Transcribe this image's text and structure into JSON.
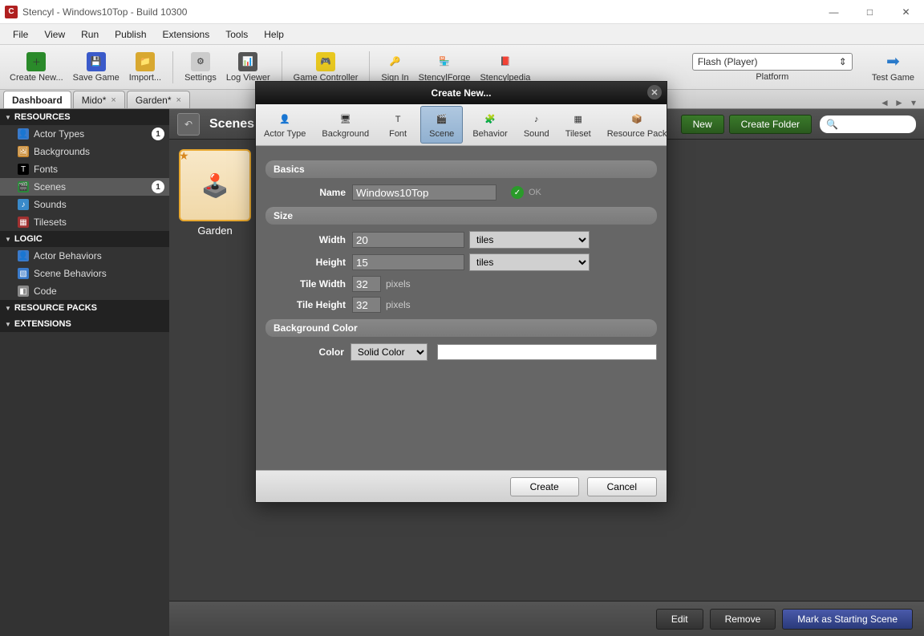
{
  "window": {
    "title": "Stencyl - Windows10Top - Build 10300"
  },
  "menu": [
    "File",
    "View",
    "Run",
    "Publish",
    "Extensions",
    "Tools",
    "Help"
  ],
  "toolbar": {
    "create_new": "Create New...",
    "save_game": "Save Game",
    "import": "Import...",
    "settings": "Settings",
    "log_viewer": "Log Viewer",
    "game_controller": "Game Controller",
    "sign_in": "Sign In",
    "stencylforge": "StencylForge",
    "stencylpedia": "Stencylpedia",
    "platform_label": "Platform",
    "platform_value": "Flash (Player)",
    "test_game": "Test Game"
  },
  "tabs": [
    {
      "label": "Dashboard",
      "active": true,
      "closable": false
    },
    {
      "label": "Mido*",
      "active": false,
      "closable": true
    },
    {
      "label": "Garden*",
      "active": false,
      "closable": true
    }
  ],
  "sidebar": {
    "groups": [
      {
        "title": "RESOURCES",
        "items": [
          {
            "label": "Actor Types",
            "icon": "actor",
            "count": "1"
          },
          {
            "label": "Backgrounds",
            "icon": "bg"
          },
          {
            "label": "Fonts",
            "icon": "font"
          },
          {
            "label": "Scenes",
            "icon": "scene",
            "count": "1",
            "active": true
          },
          {
            "label": "Sounds",
            "icon": "sound"
          },
          {
            "label": "Tilesets",
            "icon": "tile"
          }
        ]
      },
      {
        "title": "LOGIC",
        "items": [
          {
            "label": "Actor Behaviors",
            "icon": "actor"
          },
          {
            "label": "Scene Behaviors",
            "icon": "scenebeh"
          },
          {
            "label": "Code",
            "icon": "code"
          }
        ]
      },
      {
        "title": "RESOURCE PACKS",
        "items": []
      },
      {
        "title": "EXTENSIONS",
        "items": []
      }
    ]
  },
  "content": {
    "title": "Scenes",
    "create_new_btn": "New",
    "create_folder_btn": "Create Folder",
    "scene_item": "Garden",
    "footer": {
      "edit": "Edit",
      "remove": "Remove",
      "mark": "Mark as Starting Scene"
    }
  },
  "modal": {
    "title": "Create New...",
    "tabs": [
      "Actor Type",
      "Background",
      "Font",
      "Scene",
      "Behavior",
      "Sound",
      "Tileset",
      "Resource Pack"
    ],
    "active_tab": "Scene",
    "sections": {
      "basics": "Basics",
      "size": "Size",
      "bgcolor": "Background Color"
    },
    "fields": {
      "name_label": "Name",
      "name_value": "Windows10Top",
      "ok": "OK",
      "width_label": "Width",
      "width_value": "20",
      "width_unit": "tiles",
      "height_label": "Height",
      "height_value": "15",
      "height_unit": "tiles",
      "tile_w_label": "Tile Width",
      "tile_w_value": "32",
      "px": "pixels",
      "tile_h_label": "Tile Height",
      "tile_h_value": "32",
      "color_label": "Color",
      "color_mode": "Solid Color",
      "color_value": "#FFFFFF"
    },
    "buttons": {
      "create": "Create",
      "cancel": "Cancel"
    }
  }
}
